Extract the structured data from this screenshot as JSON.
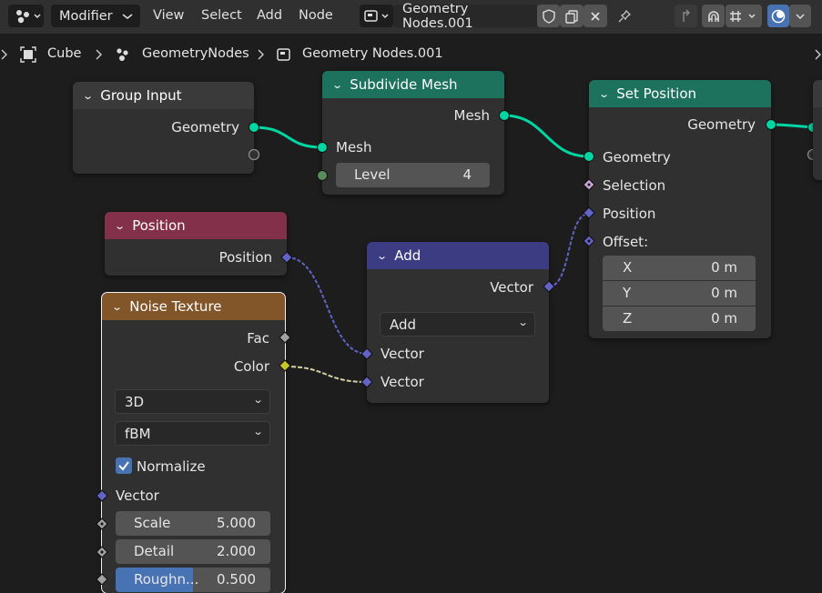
{
  "header": {
    "editor_type": "Modifier",
    "menus": [
      "View",
      "Select",
      "Add",
      "Node"
    ],
    "node_tree_name": "Geometry Nodes.001"
  },
  "breadcrumb": {
    "object": "Cube",
    "modifier": "GeometryNodes",
    "node_tree": "Geometry Nodes.001"
  },
  "colors": {
    "geometry_socket": "#00d6a3",
    "vector_socket": "#6363c7",
    "float_socket": "#a1a1a1",
    "color_socket": "#c7c729",
    "int_socket": "#598c5c",
    "geometry_header": "#1d725e",
    "input_header": "#83314a",
    "texture_header": "#83562a",
    "vector_header": "#3c3c83"
  },
  "nodes": {
    "group_input": {
      "title": "Group Input",
      "output_geometry": "Geometry"
    },
    "subdivide_mesh": {
      "title": "Subdivide Mesh",
      "output_mesh": "Mesh",
      "input_mesh": "Mesh",
      "level_label": "Level",
      "level_value": "4"
    },
    "set_position": {
      "title": "Set Position",
      "output_geometry": "Geometry",
      "input_geometry": "Geometry",
      "input_selection": "Selection",
      "input_position": "Position",
      "input_offset": "Offset:",
      "offset_x_label": "X",
      "offset_x_value": "0 m",
      "offset_y_label": "Y",
      "offset_y_value": "0 m",
      "offset_z_label": "Z",
      "offset_z_value": "0 m"
    },
    "position": {
      "title": "Position",
      "output_position": "Position"
    },
    "add": {
      "title": "Add",
      "output_vector": "Vector",
      "operation": "Add",
      "input_vector_a": "Vector",
      "input_vector_b": "Vector"
    },
    "noise_texture": {
      "title": "Noise Texture",
      "output_fac": "Fac",
      "output_color": "Color",
      "dimensions": "3D",
      "noise_type": "fBM",
      "normalize_label": "Normalize",
      "normalize_checked": true,
      "input_vector": "Vector",
      "scale_label": "Scale",
      "scale_value": "5.000",
      "detail_label": "Detail",
      "detail_value": "2.000",
      "roughness_label": "Roughn...",
      "roughness_value": "0.500",
      "roughness_fraction": 0.5
    }
  }
}
